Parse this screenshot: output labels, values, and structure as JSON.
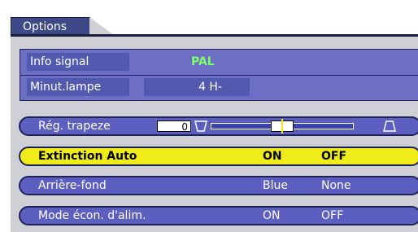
{
  "menu": {
    "tab_label": "Options"
  },
  "info": {
    "signal_label": "Info signal",
    "signal_value": "PAL",
    "lamp_label": "Minut.lampe",
    "lamp_value": "4 H-"
  },
  "settings": {
    "keystone": {
      "label": "Rég. trapeze",
      "value": "0",
      "slider_position": 0.5,
      "left_icon": "keystone-narrow-top-icon",
      "right_icon": "keystone-wide-top-icon"
    },
    "auto_power_off": {
      "label": "Extinction Auto",
      "option_a": "ON",
      "option_b": "OFF",
      "selected": true
    },
    "background": {
      "label": "Arrière-fond",
      "option_a": "Blue",
      "option_b": "None"
    },
    "power_save": {
      "label": "Mode écon. d'alim.",
      "option_a": "ON",
      "option_b": "OFF"
    }
  },
  "colors": {
    "panel": "#cfcfd6",
    "item": "#5c5fc0",
    "selected_item": "#f0ec1a",
    "signal_value": "#7cff6a",
    "border": "#1d2358"
  }
}
